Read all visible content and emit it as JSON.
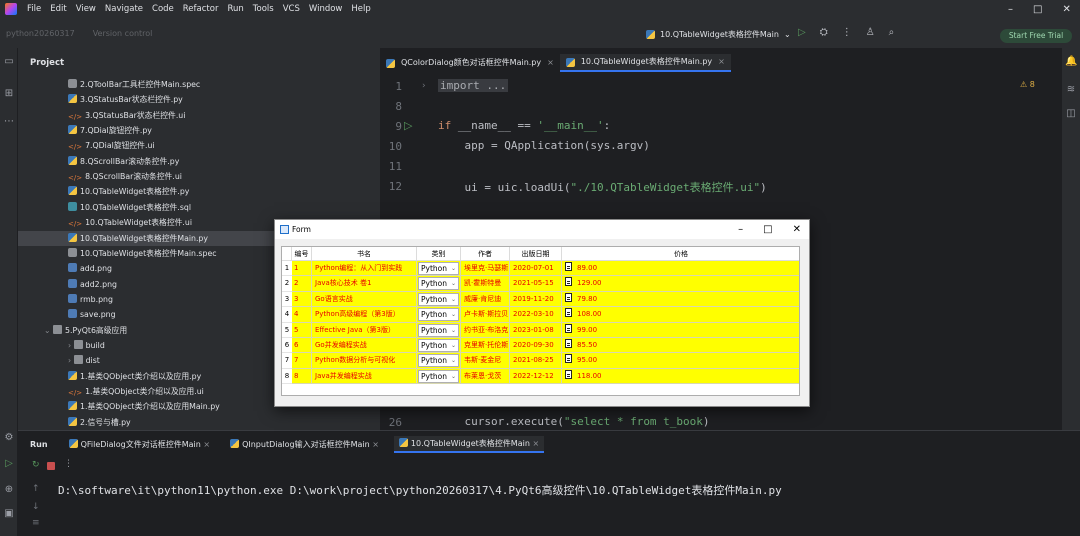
{
  "menu": [
    "File",
    "Edit",
    "View",
    "Navigate",
    "Code",
    "Refactor",
    "Run",
    "Tools",
    "VCS",
    "Window",
    "Help"
  ],
  "project_bar": {
    "project": "python20260317",
    "branch": "Version control"
  },
  "run_config": "10.QTableWidget表格控件Main",
  "start_free": "Start Free Trial",
  "project_panel": {
    "title": "Project",
    "items": [
      {
        "label": "2.QToolBar工具栏控件Main.spec",
        "type": "spec",
        "indent": 1
      },
      {
        "label": "3.QStatusBar状态栏控件.py",
        "type": "py",
        "indent": 1
      },
      {
        "label": "3.QStatusBar状态栏控件.ui",
        "type": "ui",
        "indent": 1
      },
      {
        "label": "7.QDial旋钮控件.py",
        "type": "py",
        "indent": 1
      },
      {
        "label": "7.QDial旋钮控件.ui",
        "type": "ui",
        "indent": 1
      },
      {
        "label": "8.QScrollBar滚动条控件.py",
        "type": "py",
        "indent": 1
      },
      {
        "label": "8.QScrollBar滚动条控件.ui",
        "type": "ui",
        "indent": 1
      },
      {
        "label": "10.QTableWidget表格控件.py",
        "type": "py",
        "indent": 1
      },
      {
        "label": "10.QTableWidget表格控件.sql",
        "type": "sql",
        "indent": 1
      },
      {
        "label": "10.QTableWidget表格控件.ui",
        "type": "ui",
        "indent": 1
      },
      {
        "label": "10.QTableWidget表格控件Main.py",
        "type": "py",
        "indent": 1,
        "selected": true
      },
      {
        "label": "10.QTableWidget表格控件Main.spec",
        "type": "spec",
        "indent": 1
      },
      {
        "label": "add.png",
        "type": "png",
        "indent": 1
      },
      {
        "label": "add2.png",
        "type": "png",
        "indent": 1
      },
      {
        "label": "rmb.png",
        "type": "png",
        "indent": 1
      },
      {
        "label": "save.png",
        "type": "png",
        "indent": 1
      },
      {
        "label": "5.PyQt6高级应用",
        "type": "dir",
        "indent": 0,
        "expanded": true
      },
      {
        "label": "build",
        "type": "dir",
        "indent": 1
      },
      {
        "label": "dist",
        "type": "dir",
        "indent": 1
      },
      {
        "label": "1.基类QObject类介绍以及应用.py",
        "type": "py",
        "indent": 1
      },
      {
        "label": "1.基类QObject类介绍以及应用.ui",
        "type": "ui",
        "indent": 1
      },
      {
        "label": "1.基类QObject类介绍以及应用Main.py",
        "type": "py",
        "indent": 1
      },
      {
        "label": "2.信号与槽.py",
        "type": "py",
        "indent": 1
      }
    ]
  },
  "editor": {
    "tabs": [
      {
        "label": "QColorDialog颜色对话框控件Main.py",
        "active": false
      },
      {
        "label": "10.QTableWidget表格控件Main.py",
        "active": true
      }
    ],
    "warnings": "8",
    "line_numbers": [
      "1",
      "8",
      "9",
      "10",
      "11",
      "12",
      "26"
    ],
    "lines": {
      "l1": "import ...",
      "l9_kw": "if",
      "l9_rest": " __name__ == ",
      "l9_str": "'__main__'",
      "l9_end": ":",
      "l10": "    app = QApplication(sys.argv)",
      "l12_pre": "    ui = uic.loadUi(",
      "l12_str": "\"./10.QTableWidget表格控件.ui\"",
      "l12_end": ")",
      "l26_pre": "    cursor.execute(",
      "l26_str": "\"select * from t_book",
      "l26_end": ")"
    }
  },
  "run_panel": {
    "label": "Run",
    "tabs": [
      {
        "label": "QFileDialog文件对话框控件Main",
        "active": false
      },
      {
        "label": "QInputDialog输入对话框控件Main",
        "active": false
      },
      {
        "label": "10.QTableWidget表格控件Main",
        "active": true
      }
    ],
    "command": "D:\\software\\it\\python11\\python.exe D:\\work\\project\\python20260317\\4.PyQt6高级控件\\10.QTableWidget表格控件Main.py"
  },
  "form": {
    "title": "Form",
    "columns": [
      "编号",
      "书名",
      "类别",
      "作者",
      "出版日期",
      "价格"
    ],
    "rows": [
      {
        "n": "1",
        "id": "1",
        "name": "Python编程：从入门到实践",
        "cat": "Python",
        "author": "埃里克·马瑟斯",
        "date": "2020-07-01",
        "price": "89.00"
      },
      {
        "n": "2",
        "id": "2",
        "name": "Java核心技术 卷1",
        "cat": "Python",
        "author": "凯·霍斯特曼",
        "date": "2021-05-15",
        "price": "129.00"
      },
      {
        "n": "3",
        "id": "3",
        "name": "Go语言实战",
        "cat": "Python",
        "author": "威廉·肯尼迪",
        "date": "2019-11-20",
        "price": "79.80"
      },
      {
        "n": "4",
        "id": "4",
        "name": "Python高级编程（第3版）",
        "cat": "Python",
        "author": "卢卡斯·斯拉贝",
        "date": "2022-03-10",
        "price": "108.00"
      },
      {
        "n": "5",
        "id": "5",
        "name": "Effective Java（第3版）",
        "cat": "Python",
        "author": "约书亚·布洛克",
        "date": "2023-01-08",
        "price": "99.00"
      },
      {
        "n": "6",
        "id": "6",
        "name": "Go并发编程实战",
        "cat": "Python",
        "author": "克里斯·托伦斯",
        "date": "2020-09-30",
        "price": "85.50"
      },
      {
        "n": "7",
        "id": "7",
        "name": "Python数据分析与可视化",
        "cat": "Python",
        "author": "韦斯·麦金尼",
        "date": "2021-08-25",
        "price": "95.00"
      },
      {
        "n": "8",
        "id": "8",
        "name": "Java并发编程实战",
        "cat": "Python",
        "author": "布莱恩·戈茨",
        "date": "2022-12-12",
        "price": "118.00"
      }
    ]
  }
}
